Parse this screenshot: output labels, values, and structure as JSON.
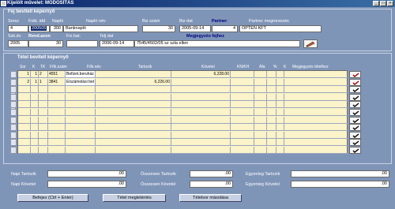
{
  "window": {
    "title": "Kijelölt művelet: MÓDOSÍTÁS"
  },
  "header": {
    "section_title": "Fej bevitell képernyő",
    "labels": {
      "sorsz": "Sorsz",
      "fokt_idd": "Fokt. idd",
      "naplo": "Napló",
      "naplo_nev": "Napló név",
      "biz_szam": "Biz szám",
      "biz_dat": "Biz dat",
      "partner": "Partner",
      "partner_megnevezes": "Partner megnevezés",
      "szk_ev": "Szk.év",
      "rend_azon": "Rend.azon",
      "fiz_hat": "Fiz.hat.",
      "telj_dat": "Telj dat",
      "megjegyzes_fejhez": "Megjegyzés fejhez"
    },
    "values": {
      "sorsz": "4",
      "fokt_idd": "200505",
      "naplo": "300",
      "naplo_nev": "Banknapló",
      "biz_szam": "30",
      "biz_dat": "2005-09-14",
      "partner": "4",
      "partner_megnevezes": "OPTEN KFT",
      "szk_ev": "2005",
      "rend_azon": "30",
      "fiz_hat": "",
      "telj_dat": "2006-09-14",
      "megjegyzes": "7545/4502/05 sz szla ellen"
    }
  },
  "items": {
    "section_title": "Tétel bevitell képernyő",
    "columns": [
      "Sor",
      "K",
      "TK",
      "Fők.szám",
      "Fők.név",
      "Tartozik",
      "Követel",
      "KN/KH",
      "Áfa",
      "%",
      "K",
      "Megjegyzés tételhez"
    ],
    "rows": [
      [
        "1",
        "1",
        "2",
        "4551",
        "Befizet.beruház",
        "",
        "6,228.00",
        "",
        "",
        "",
        "",
        ""
      ],
      [
        "2",
        "1",
        "1",
        "3841",
        "Elszámolási bet",
        "6,226.00",
        "",
        "",
        "",
        "",
        "",
        ""
      ]
    ]
  },
  "totals": {
    "napi_tartozik_label": "Napi Tartozik",
    "napi_tartozik": ".00",
    "osszesen_tartozik_label": "Összesen Tartozik",
    "osszesen_tartozik": ".00",
    "egyenleg_tartozik_label": "Egyenleg Tartozik",
    "egyenleg_tartozik": ".00",
    "napi_kovetel_label": "Napi Követel",
    "napi_kovetel": ".00",
    "osszesen_kovetel_label": "Összesen Követel",
    "osszesen_kovetel": ".00",
    "egyenleg_kovetel_label": "Egyenleg Követel",
    "egyenleg_kovetel": ".00"
  },
  "buttons": {
    "befejez": "Befejez (Ctrl + Enter)",
    "tetel_megtekintes": "Tétel megtekintés",
    "tetelsor_masolasa": "Tételsor másolása"
  },
  "icons": {
    "edit": "pencil-icon",
    "row_mark": "checkmark-icon"
  }
}
